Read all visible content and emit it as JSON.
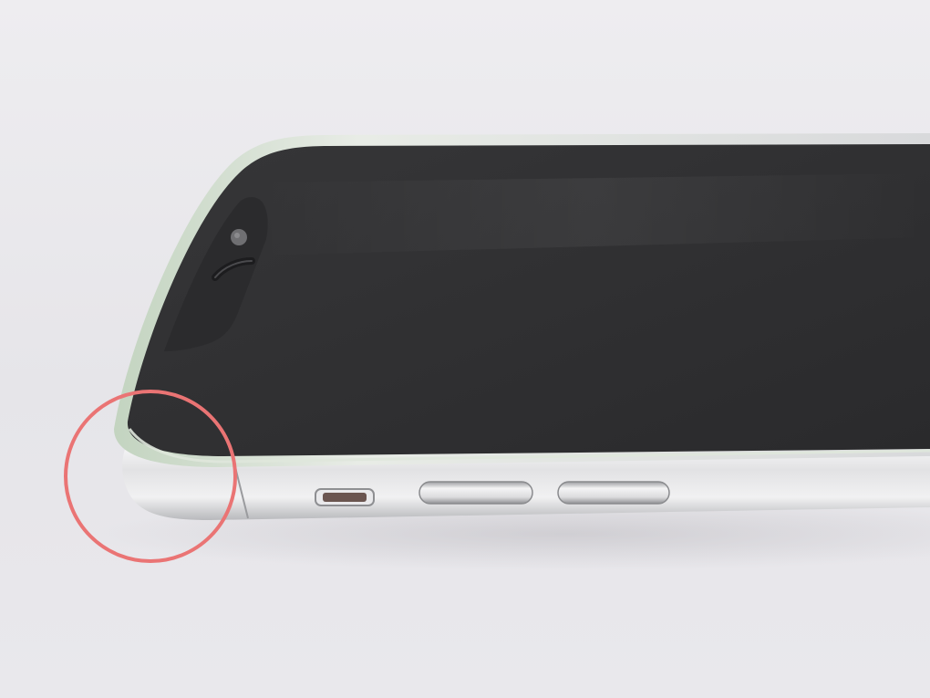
{
  "scene": {
    "subject": "smartphone-photo",
    "colors": {
      "background_light": "#ecebee",
      "background_mid": "#e1dfe3",
      "background_shadow": "#c9c7cc",
      "screen_dark": "#2f2f31",
      "screen_glare": "#3f3f42",
      "frame_silver_light": "#f4f4f5",
      "frame_silver_mid": "#c7c8ca",
      "frame_silver_dark": "#8c8d90",
      "frame_green_tint": "#c9d8c6",
      "button_silver": "#e6e6e8",
      "camera_dot": "#6f6f72",
      "highlight_ring": "#ea7474"
    },
    "annotation": {
      "shape": "circle",
      "marks": "phone-corner"
    }
  }
}
